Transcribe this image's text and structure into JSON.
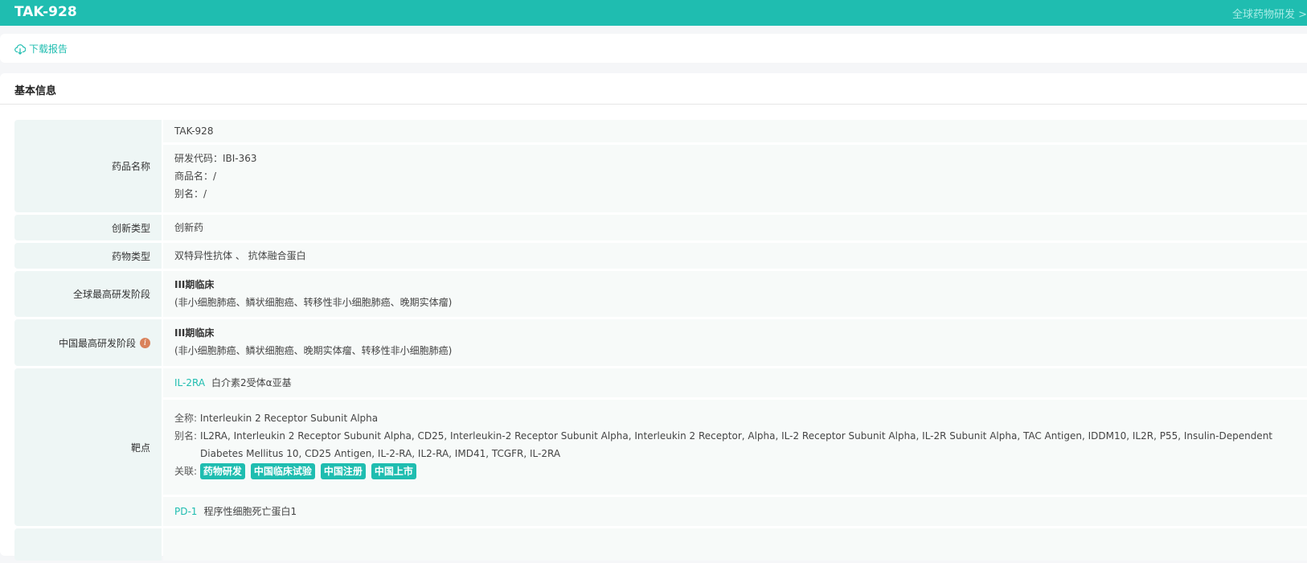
{
  "header": {
    "title": "TAK-928",
    "global_link": "全球药物研发 >"
  },
  "toolbar": {
    "download": "下载报告"
  },
  "section": {
    "title": "基本信息"
  },
  "rows": {
    "name": {
      "label": "药品名称",
      "value": "TAK-928",
      "code": "研发代码：IBI-363",
      "trade": "商品名：/",
      "alias": "别名：/"
    },
    "innovation": {
      "label": "创新类型",
      "value": "创新药"
    },
    "drug_type": {
      "label": "药物类型",
      "value": "双特异性抗体 、 抗体融合蛋白"
    },
    "global_stage": {
      "label": "全球最高研发阶段",
      "stage": "III期临床",
      "indications": "(非小细胞肺癌、鳞状细胞癌、转移性非小细胞肺癌、晚期实体瘤)"
    },
    "china_stage": {
      "label": "中国最高研发阶段",
      "info_icon": "i",
      "stage": "III期临床",
      "indications": "(非小细胞肺癌、鳞状细胞癌、晚期实体瘤、转移性非小细胞肺癌)"
    },
    "target": {
      "label": "靶点",
      "t1": {
        "code": "IL-2RA",
        "name": "白介素2受体α亚基",
        "full_label": "全称:",
        "full": "Interleukin 2 Receptor Subunit Alpha",
        "alias_label": "别名:",
        "alias": "IL2RA, Interleukin 2 Receptor Subunit Alpha, CD25, Interleukin-2 Receptor Subunit Alpha, Interleukin 2 Receptor, Alpha, IL-2 Receptor Subunit Alpha, IL-2R Subunit Alpha, TAC Antigen, IDDM10, IL2R, P55, Insulin-Dependent Diabetes Mellitus 10, CD25 Antigen, IL-2-RA, IL2-RA, IMD41, TCGFR, IL-2RA",
        "rel_label": "关联:",
        "tags": [
          "药物研发",
          "中国临床试验",
          "中国注册",
          "中国上市"
        ]
      },
      "t2": {
        "code": "PD-1",
        "name": "程序性细胞死亡蛋白1"
      }
    }
  }
}
